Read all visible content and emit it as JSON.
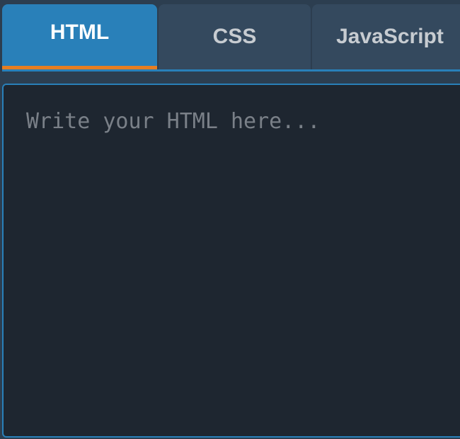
{
  "tabs": [
    {
      "label": "HTML",
      "active": true
    },
    {
      "label": "CSS",
      "active": false
    },
    {
      "label": "JavaScript",
      "active": false
    }
  ],
  "editor": {
    "value": "",
    "placeholder": "Write your HTML here..."
  },
  "colors": {
    "background": "#2c3e50",
    "tab_inactive": "#34495e",
    "tab_active": "#2980b9",
    "tab_active_indicator": "#e67e22",
    "editor_background": "#1e2630",
    "accent_border": "#2980b9"
  }
}
